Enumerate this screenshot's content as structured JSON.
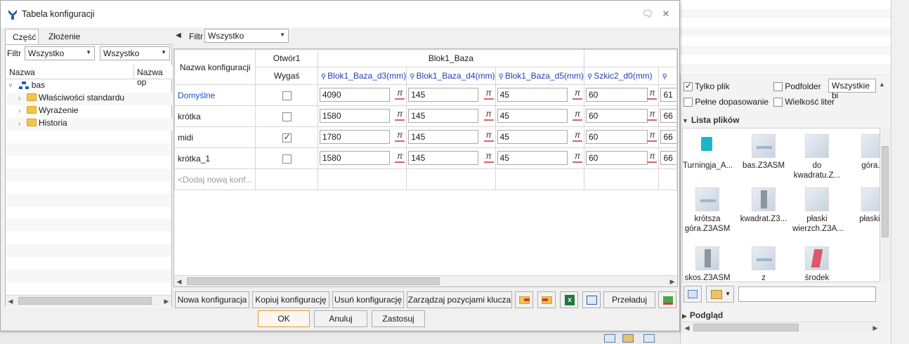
{
  "dialog": {
    "title": "Tabela konfiguracji",
    "tabs": [
      "Część",
      "Złożenie"
    ],
    "left": {
      "filter_label": "Filtr",
      "filter1": "Wszystko",
      "filter2": "Wszystko",
      "col_name": "Nazwa",
      "col_name2": "Nazwa op",
      "tree": [
        {
          "label": "bas",
          "type": "root"
        },
        {
          "label": "Właściwości standardu",
          "type": "folder"
        },
        {
          "label": "Wyrażenie",
          "type": "folder"
        },
        {
          "label": "Historia",
          "type": "folder"
        }
      ]
    },
    "right": {
      "filter_label": "Filtr",
      "filter_value": "Wszystko",
      "header_name": "Nazwa konfiguracji",
      "group1": "Otwór1",
      "group1_sub": "Wygaś",
      "group2": "Blok1_Baza",
      "params": [
        "Blok1_Baza_d3(mm)",
        "Blok1_Baza_d4(mm)",
        "Blok1_Baza_d5(mm)",
        "Szkic2_d0(mm)",
        ""
      ],
      "pi_symbol": "π",
      "rows": [
        {
          "name": "Domyślne",
          "checked": false,
          "values": [
            "4090",
            "145",
            "45",
            "60",
            "61"
          ]
        },
        {
          "name": "krótka",
          "checked": false,
          "values": [
            "1580",
            "145",
            "45",
            "60",
            "66"
          ]
        },
        {
          "name": "midi",
          "checked": true,
          "values": [
            "1780",
            "145",
            "45",
            "60",
            "66"
          ]
        },
        {
          "name": "krótka_1",
          "checked": false,
          "values": [
            "1580",
            "145",
            "45",
            "60",
            "66"
          ]
        }
      ],
      "add_placeholder": "<Dodaj nową konf..."
    },
    "buttons": {
      "new_config": "Nowa konfiguracja",
      "copy_config": "Kopiuj konfigurację",
      "delete_config": "Usuń konfigurację",
      "manage_keys": "Zarządzaj pozycjami klucza",
      "reload": "Przeładuj",
      "ok": "OK",
      "cancel": "Anuluj",
      "apply": "Zastosuj"
    }
  },
  "file_panel": {
    "only_file": "Tylko plik",
    "subfolder": "Podfolder",
    "all_select": "Wszystkie bi",
    "full_match": "Pełne dopasowanie",
    "case": "Wielkość liter",
    "file_list_title": "Lista plików",
    "preview_title": "Podgląd",
    "files": [
      [
        "Turningja_A...",
        ""
      ],
      [
        "bas.Z3ASM",
        ""
      ],
      [
        "do",
        "kwadratu.Z..."
      ],
      [
        "góra.Z",
        ""
      ],
      [
        "krótsza",
        "góra.Z3ASM"
      ],
      [
        "kwadrat.Z3...",
        ""
      ],
      [
        "płaski",
        "wierzch.Z3A..."
      ],
      [
        "płaski.Z",
        ""
      ],
      [
        "skos.Z3ASM",
        ""
      ],
      [
        "z",
        ""
      ],
      [
        "środek",
        ""
      ]
    ]
  }
}
